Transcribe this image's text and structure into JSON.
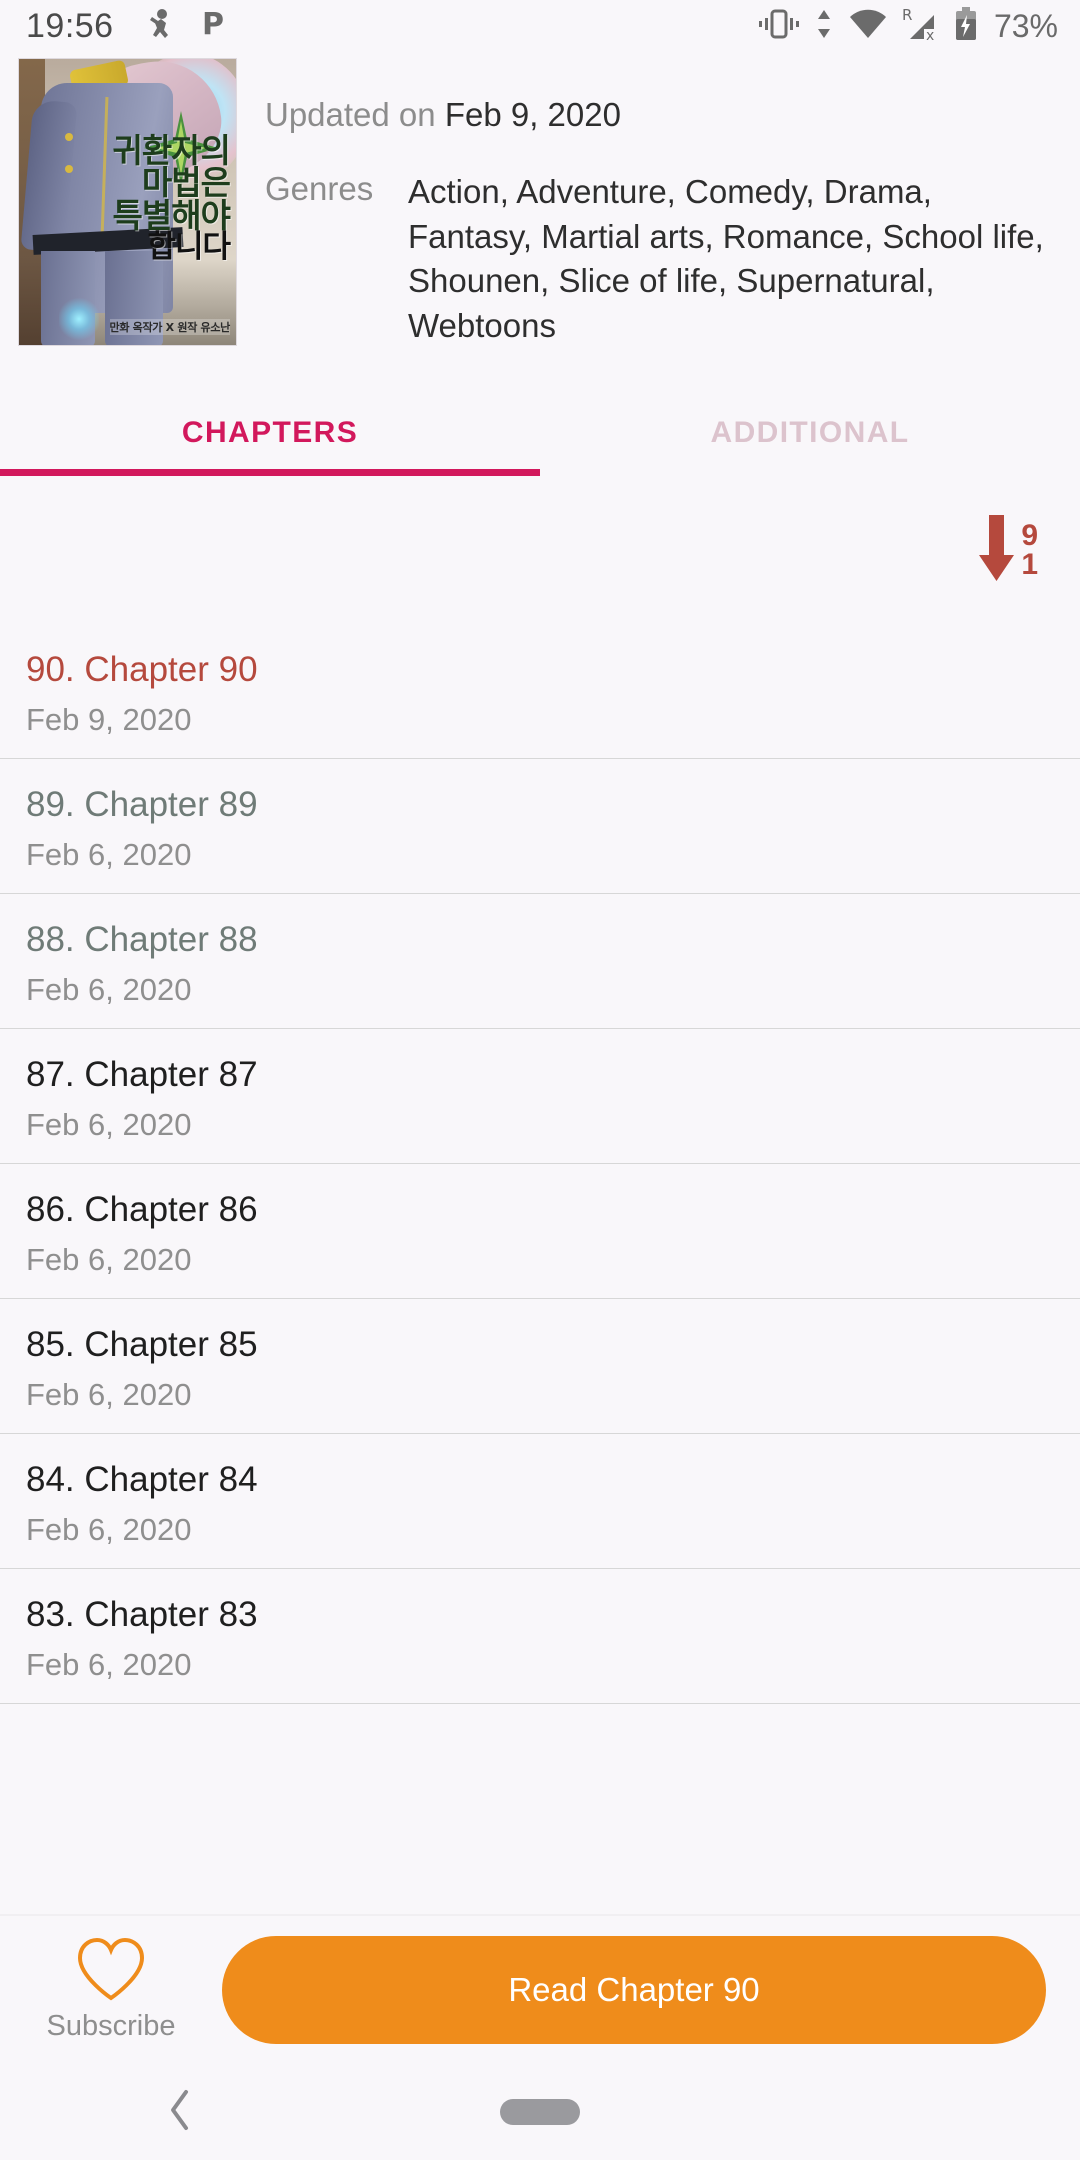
{
  "status_bar": {
    "time": "19:56",
    "notification_icons": [
      "person-running-icon",
      "p-app-icon"
    ],
    "system_icons": [
      "vibrate-icon",
      "data-transfer-icon",
      "wifi-icon",
      "roaming-signal-icon",
      "charging-battery-icon"
    ],
    "roaming_label": "R",
    "battery_percent": "73%"
  },
  "header": {
    "cover": {
      "alt": "manhwa-cover-thumbnail",
      "title_lines": [
        "귀환자의",
        "마법은",
        "특별해야",
        "합니다"
      ],
      "credits": "만화 옥작가 X 원작 유소난",
      "credits_separator": "X"
    },
    "updated_label": "Updated on",
    "updated_value": "Feb 9, 2020",
    "genres_label": "Genres",
    "genres_value": "Action, Adventure, Comedy, Drama, Fantasy, Martial arts, Romance, School life, Shounen, Slice of life, Supernatural, Webtoons"
  },
  "tabs": [
    {
      "label": "CHAPTERS",
      "active": true
    },
    {
      "label": "ADDITIONAL",
      "active": false
    }
  ],
  "sort": {
    "icon": "sort-descending-icon",
    "top_digit": "9",
    "bottom_digit": "1"
  },
  "chapters": [
    {
      "title": "90. Chapter 90",
      "date": "Feb 9, 2020",
      "state": "current"
    },
    {
      "title": "89. Chapter 89",
      "date": "Feb 6, 2020",
      "state": "read"
    },
    {
      "title": "88. Chapter 88",
      "date": "Feb 6, 2020",
      "state": "read"
    },
    {
      "title": "87. Chapter 87",
      "date": "Feb 6, 2020",
      "state": "unread"
    },
    {
      "title": "86. Chapter 86",
      "date": "Feb 6, 2020",
      "state": "unread"
    },
    {
      "title": "85. Chapter 85",
      "date": "Feb 6, 2020",
      "state": "unread"
    },
    {
      "title": "84. Chapter 84",
      "date": "Feb 6, 2020",
      "state": "unread"
    },
    {
      "title": "83. Chapter 83",
      "date": "Feb 6, 2020",
      "state": "unread"
    }
  ],
  "bottom_bar": {
    "subscribe_label": "Subscribe",
    "subscribe_icon": "heart-outline-icon",
    "read_button_label": "Read Chapter 90"
  },
  "navigation_bar": {
    "back_icon": "back-chevron-icon",
    "home_icon": "home-pill-icon"
  },
  "colors": {
    "accent_pink": "#d2185c",
    "accent_pink_faded": "#dcc3cd",
    "brick_red": "#b5493d",
    "orange": "#ef8c1b",
    "background": "#f9f7fa",
    "text_dark": "#1f1f1f",
    "text_muted": "#8c8c8c",
    "text_read": "#6f7b77"
  }
}
